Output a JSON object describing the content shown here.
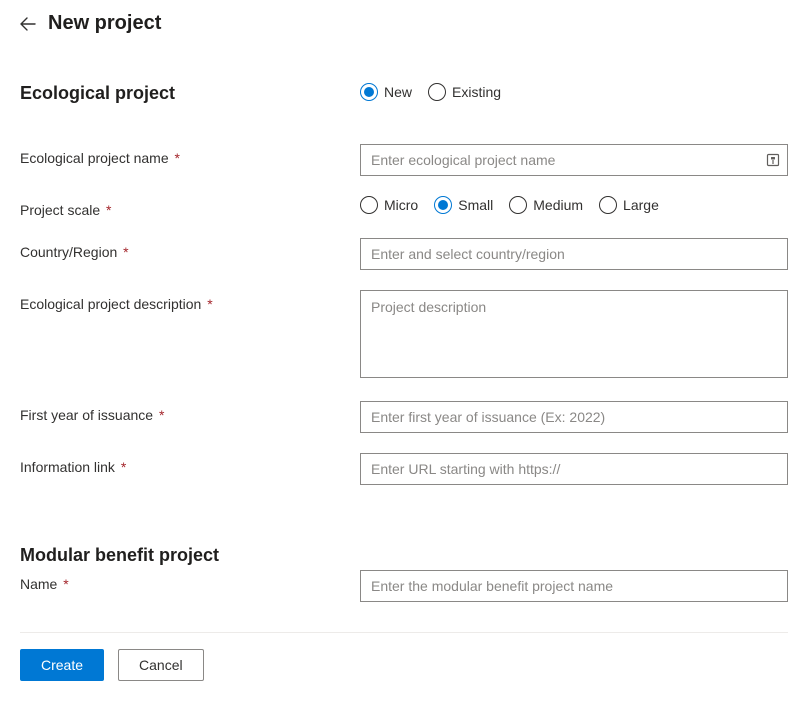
{
  "header": {
    "title": "New project"
  },
  "section1": {
    "title": "Ecological project",
    "type_radio": {
      "options": [
        {
          "label": "New",
          "selected": true
        },
        {
          "label": "Existing",
          "selected": false
        }
      ]
    },
    "name": {
      "label": "Ecological project name",
      "placeholder": "Enter ecological project name",
      "value": ""
    },
    "scale": {
      "label": "Project scale",
      "options": [
        {
          "label": "Micro",
          "selected": false
        },
        {
          "label": "Small",
          "selected": true
        },
        {
          "label": "Medium",
          "selected": false
        },
        {
          "label": "Large",
          "selected": false
        }
      ]
    },
    "country": {
      "label": "Country/Region",
      "placeholder": "Enter and select country/region",
      "value": ""
    },
    "description": {
      "label": "Ecological project description",
      "placeholder": "Project description",
      "value": ""
    },
    "first_year": {
      "label": "First year of issuance",
      "placeholder": "Enter first year of issuance (Ex: 2022)",
      "value": ""
    },
    "info_link": {
      "label": "Information link",
      "placeholder": "Enter URL starting with https://",
      "value": ""
    }
  },
  "section2": {
    "title": "Modular benefit project",
    "name": {
      "label": "Name",
      "placeholder": "Enter the modular benefit project name",
      "value": ""
    }
  },
  "footer": {
    "create_label": "Create",
    "cancel_label": "Cancel"
  }
}
